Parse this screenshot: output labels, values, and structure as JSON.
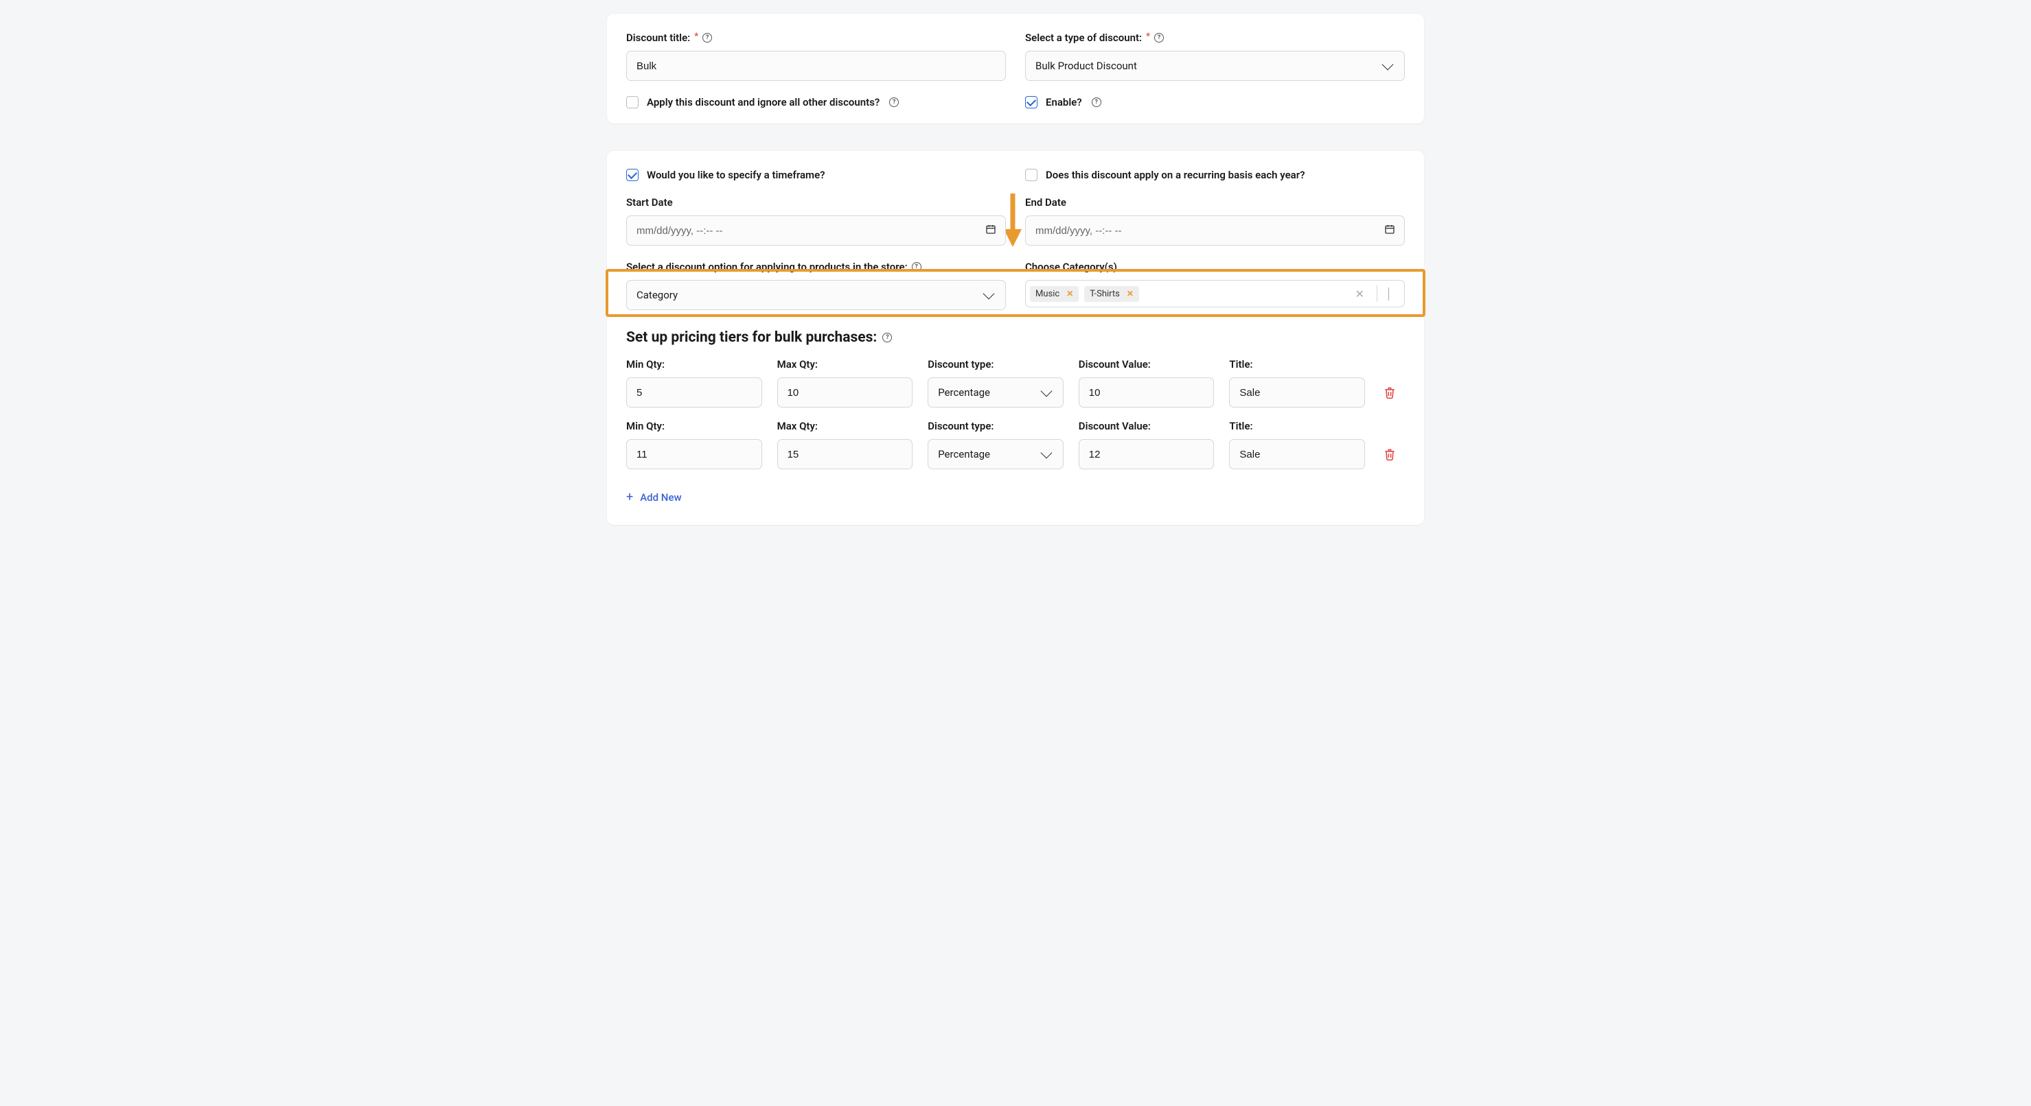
{
  "card1": {
    "discount_title_label": "Discount title:",
    "discount_title_value": "Bulk",
    "discount_type_label": "Select a type of discount:",
    "discount_type_value": "Bulk Product Discount",
    "ignore_others_label": "Apply this discount and ignore all other discounts?",
    "ignore_others_checked": false,
    "enable_label": "Enable?",
    "enable_checked": true
  },
  "card2": {
    "timeframe_label": "Would you like to specify a timeframe?",
    "timeframe_checked": true,
    "recurring_label": "Does this discount apply on a recurring basis each year?",
    "recurring_checked": false,
    "start_date_label": "Start Date",
    "start_date_placeholder": "mm/dd/yyyy, --:-- --",
    "end_date_label": "End Date",
    "end_date_placeholder": "mm/dd/yyyy, --:-- --",
    "discount_option_label": "Select a discount option for applying to products in the store:",
    "discount_option_value": "Category",
    "choose_category_label": "Choose Category(s)",
    "category_tags": [
      "Music",
      "T-Shirts"
    ],
    "tiers_heading": "Set up pricing tiers for bulk purchases:",
    "col_labels": {
      "min": "Min Qty:",
      "max": "Max Qty:",
      "dtype": "Discount type:",
      "dval": "Discount Value:",
      "title": "Title:"
    },
    "tiers": [
      {
        "min": "5",
        "max": "10",
        "dtype": "Percentage",
        "dval": "10",
        "title": "Sale"
      },
      {
        "min": "11",
        "max": "15",
        "dtype": "Percentage",
        "dval": "12",
        "title": "Sale"
      }
    ],
    "add_new_label": "Add New"
  }
}
